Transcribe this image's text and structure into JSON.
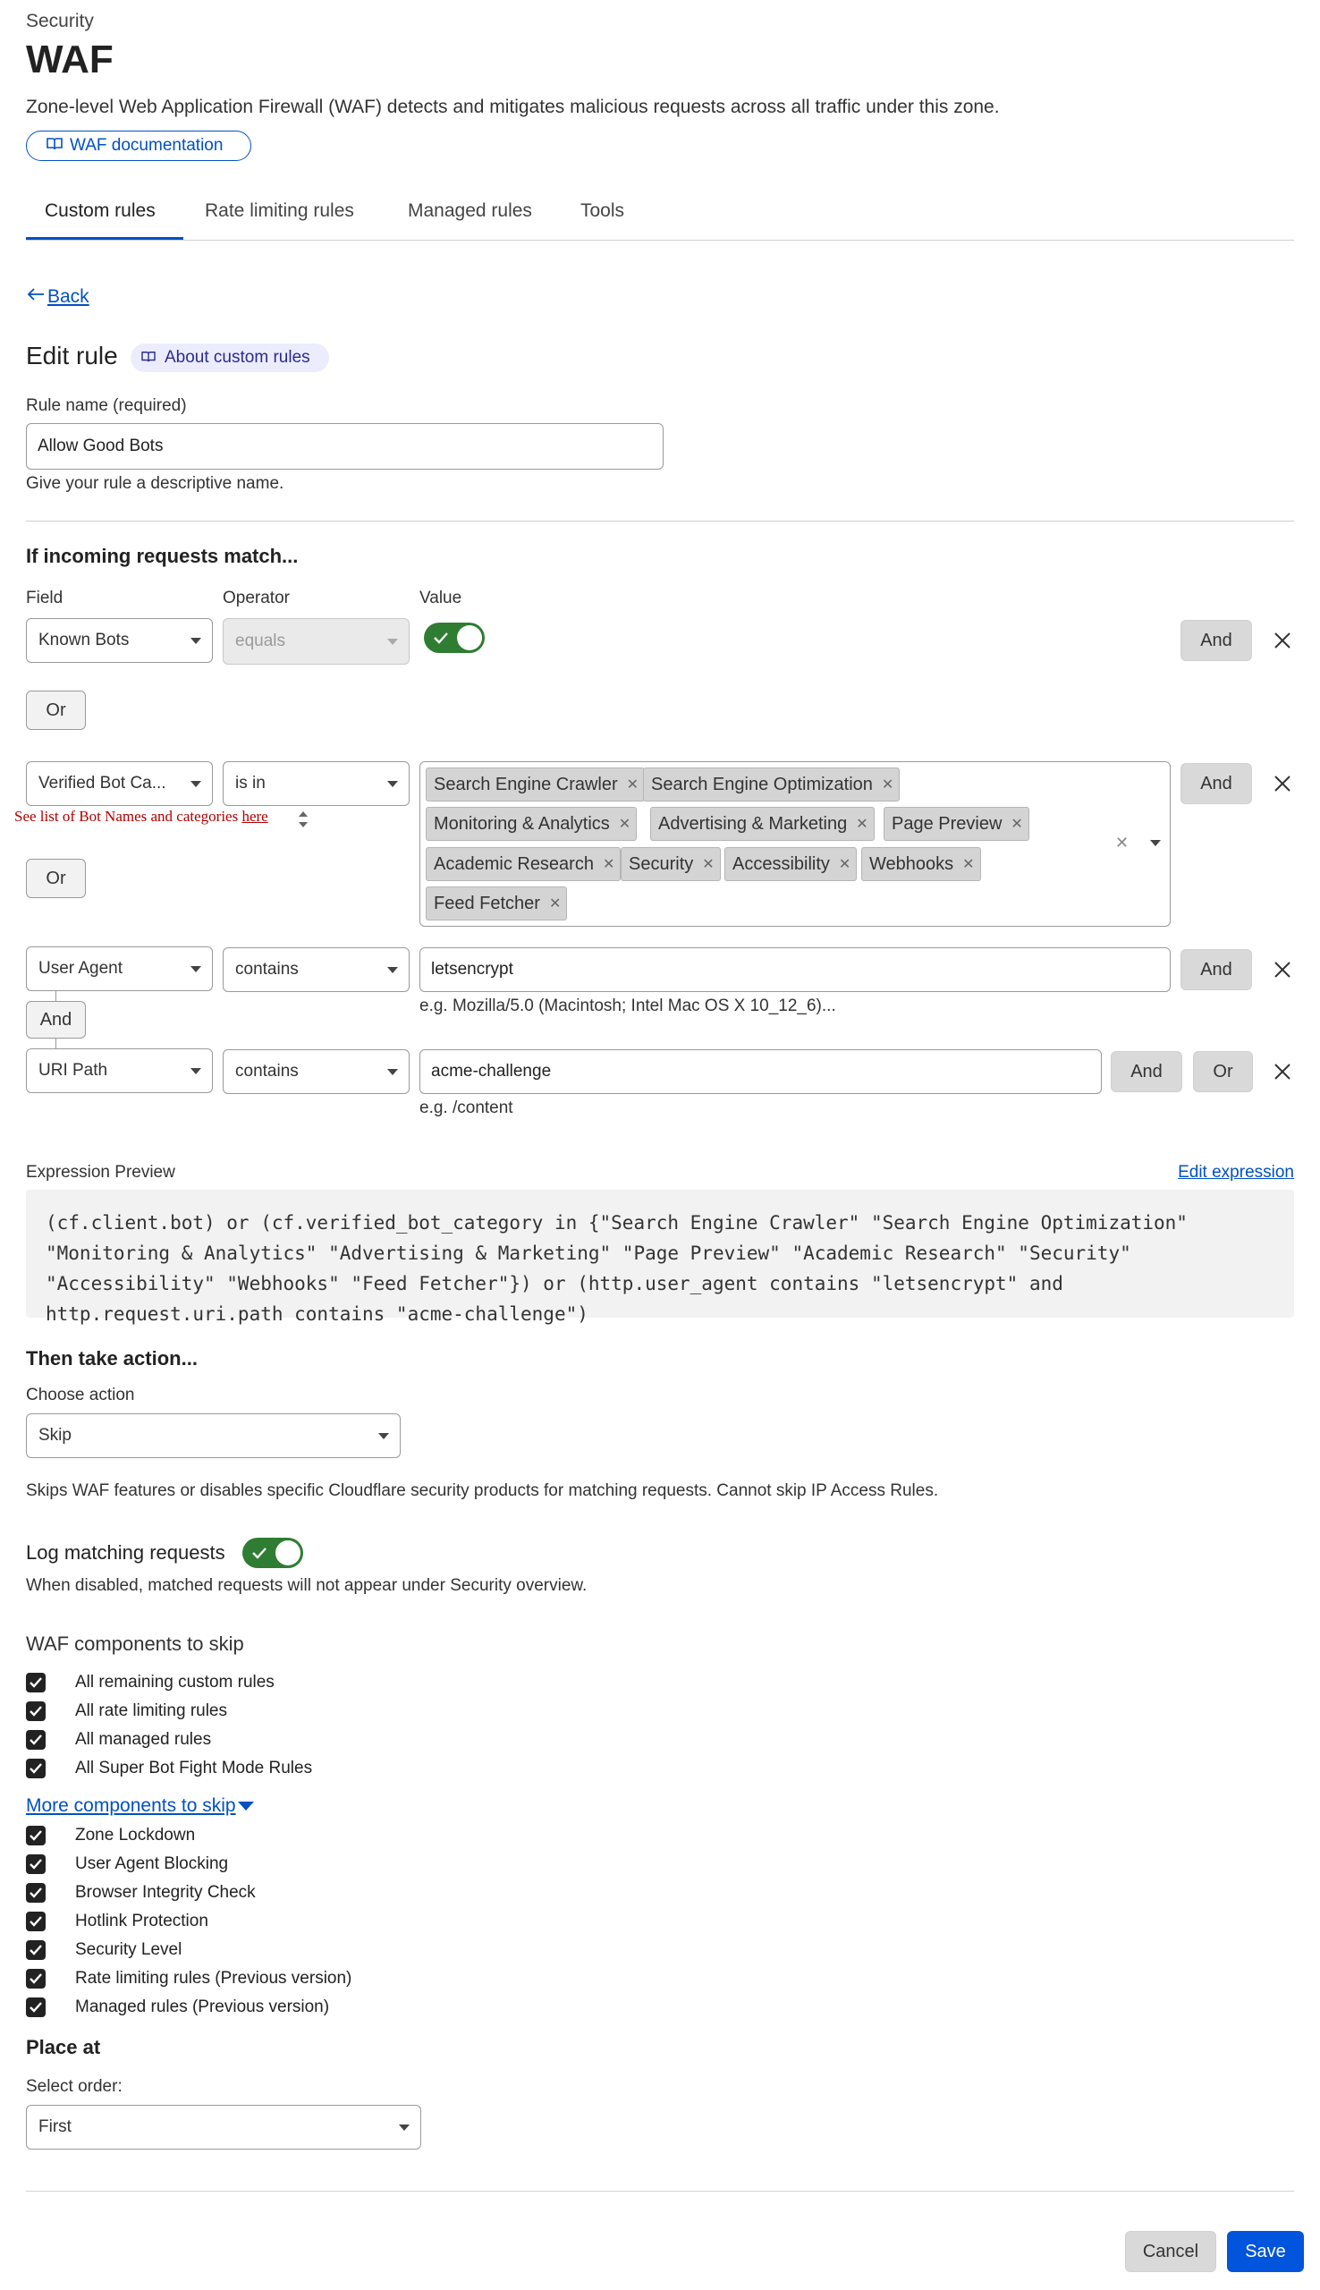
{
  "header": {
    "breadcrumb": "Security",
    "title": "WAF",
    "description": "Zone-level Web Application Firewall (WAF) detects and mitigates malicious requests across all traffic under this zone.",
    "docs_link": "WAF documentation"
  },
  "tabs": [
    {
      "label": "Custom rules",
      "active": true
    },
    {
      "label": "Rate limiting rules",
      "active": false
    },
    {
      "label": "Managed rules",
      "active": false
    },
    {
      "label": "Tools",
      "active": false
    }
  ],
  "back_label": "Back",
  "edit_rule": {
    "heading": "Edit rule",
    "about_link": "About custom rules",
    "rule_name_label": "Rule name (required)",
    "rule_name_value": "Allow Good Bots",
    "rule_name_help": "Give your rule a descriptive name."
  },
  "match": {
    "heading": "If incoming requests match...",
    "col_field": "Field",
    "col_operator": "Operator",
    "col_value": "Value",
    "row1": {
      "field": "Known Bots",
      "operator": "equals",
      "value_on": true,
      "and_label": "And"
    },
    "or1_label": "Or",
    "row2": {
      "field": "Verified Bot Ca...",
      "operator": "is in",
      "chips": [
        "Search Engine Crawler",
        "Search Engine Optimization",
        "Monitoring & Analytics",
        "Advertising & Marketing",
        "Page Preview",
        "Academic Research",
        "Security",
        "Accessibility",
        "Webhooks",
        "Feed Fetcher"
      ],
      "hint_text": "See list of Bot Names and categories",
      "hint_link": "here",
      "and_label": "And"
    },
    "or2_label": "Or",
    "row3": {
      "field": "User Agent",
      "operator": "contains",
      "value": "letsencrypt",
      "example": "e.g. Mozilla/5.0 (Macintosh; Intel Mac OS X 10_12_6)...",
      "and_label": "And"
    },
    "and_connector": "And",
    "row4": {
      "field": "URI Path",
      "operator": "contains",
      "value": "acme-challenge",
      "example": "e.g. /content",
      "and_label": "And",
      "or_label": "Or"
    }
  },
  "expression": {
    "label": "Expression Preview",
    "edit_link": "Edit expression",
    "code": "(cf.client.bot) or (cf.verified_bot_category in {\"Search Engine Crawler\" \"Search Engine Optimization\" \"Monitoring & Analytics\" \"Advertising & Marketing\" \"Page Preview\" \"Academic Research\" \"Security\" \"Accessibility\" \"Webhooks\" \"Feed Fetcher\"}) or (http.user_agent contains \"letsencrypt\" and http.request.uri.path contains \"acme-challenge\")"
  },
  "action": {
    "heading": "Then take action...",
    "choose_label": "Choose action",
    "selected": "Skip",
    "help": "Skips WAF features or disables specific Cloudflare security products for matching requests. Cannot skip IP Access Rules."
  },
  "logging": {
    "label": "Log matching requests",
    "enabled": true,
    "help": "When disabled, matched requests will not appear under Security overview."
  },
  "skip_components": {
    "heading": "WAF components to skip",
    "items": [
      "All remaining custom rules",
      "All rate limiting rules",
      "All managed rules",
      "All Super Bot Fight Mode Rules"
    ],
    "more_link": "More components to skip",
    "more_items": [
      "Zone Lockdown",
      "User Agent Blocking",
      "Browser Integrity Check",
      "Hotlink Protection",
      "Security Level",
      "Rate limiting rules (Previous version)",
      "Managed rules (Previous version)"
    ]
  },
  "place": {
    "heading": "Place at",
    "order_label": "Select order:",
    "selected": "First"
  },
  "footer": {
    "cancel": "Cancel",
    "save": "Save"
  },
  "colors": {
    "accent": "#0051c3",
    "toggle_on": "#2e7d32",
    "save_bg": "#0055dc",
    "pill_bg": "#ececff"
  }
}
